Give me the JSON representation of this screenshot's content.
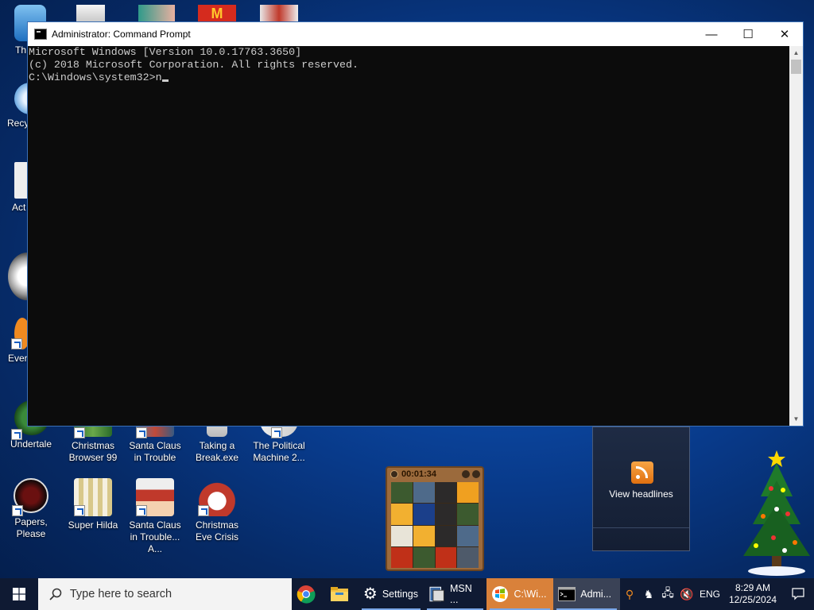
{
  "desktop": {
    "icons": [
      {
        "label": "Th"
      },
      {
        "label": "Recy"
      },
      {
        "label": "Act"
      },
      {
        "label": "Ever"
      },
      {
        "label": "Undertale"
      },
      {
        "label": "Christmas Browser 99"
      },
      {
        "label": "Santa Claus in Trouble"
      },
      {
        "label": "Taking a Break.exe"
      },
      {
        "label": "The Political Machine 2..."
      },
      {
        "label": "Papers, Please"
      },
      {
        "label": "Super Hilda"
      },
      {
        "label": "Santa Claus in Trouble... A..."
      },
      {
        "label": "Christmas Eve Crisis"
      }
    ]
  },
  "cmd_window": {
    "title": "Administrator: Command Prompt",
    "lines": [
      "Microsoft Windows [Version 10.0.17763.3650]",
      "(c) 2018 Microsoft Corporation. All rights reserved.",
      "",
      "C:\\Windows\\system32>n"
    ],
    "controls": {
      "minimize": "—",
      "maximize": "☐",
      "close": "✕"
    }
  },
  "puzzle_gadget": {
    "timer": "00:01:34",
    "tile_colors": [
      "#3c5a2f",
      "#4e6a8a",
      "#2c2a2a",
      "#f0a020",
      "#f2b030",
      "#1b3f8a",
      "#2c2a2a",
      "#3c5a2f",
      "#e8e4d8",
      "#f2b030",
      "#2c2a2a",
      "#4e6a8a",
      "#c03018",
      "#3c5a2f",
      "#c03018",
      "#4e5a6a"
    ]
  },
  "msn_gadget": {
    "label": "View headlines"
  },
  "taskbar": {
    "search_placeholder": "Type here to search",
    "items": [
      {
        "label": ""
      },
      {
        "label": ""
      },
      {
        "label": "Settings"
      },
      {
        "label": "MSN ..."
      },
      {
        "label": "C:\\Wi..."
      },
      {
        "label": "Admi..."
      }
    ],
    "tray": {
      "language": "ENG",
      "time": "8:29 AM",
      "date": "12/25/2024"
    }
  }
}
